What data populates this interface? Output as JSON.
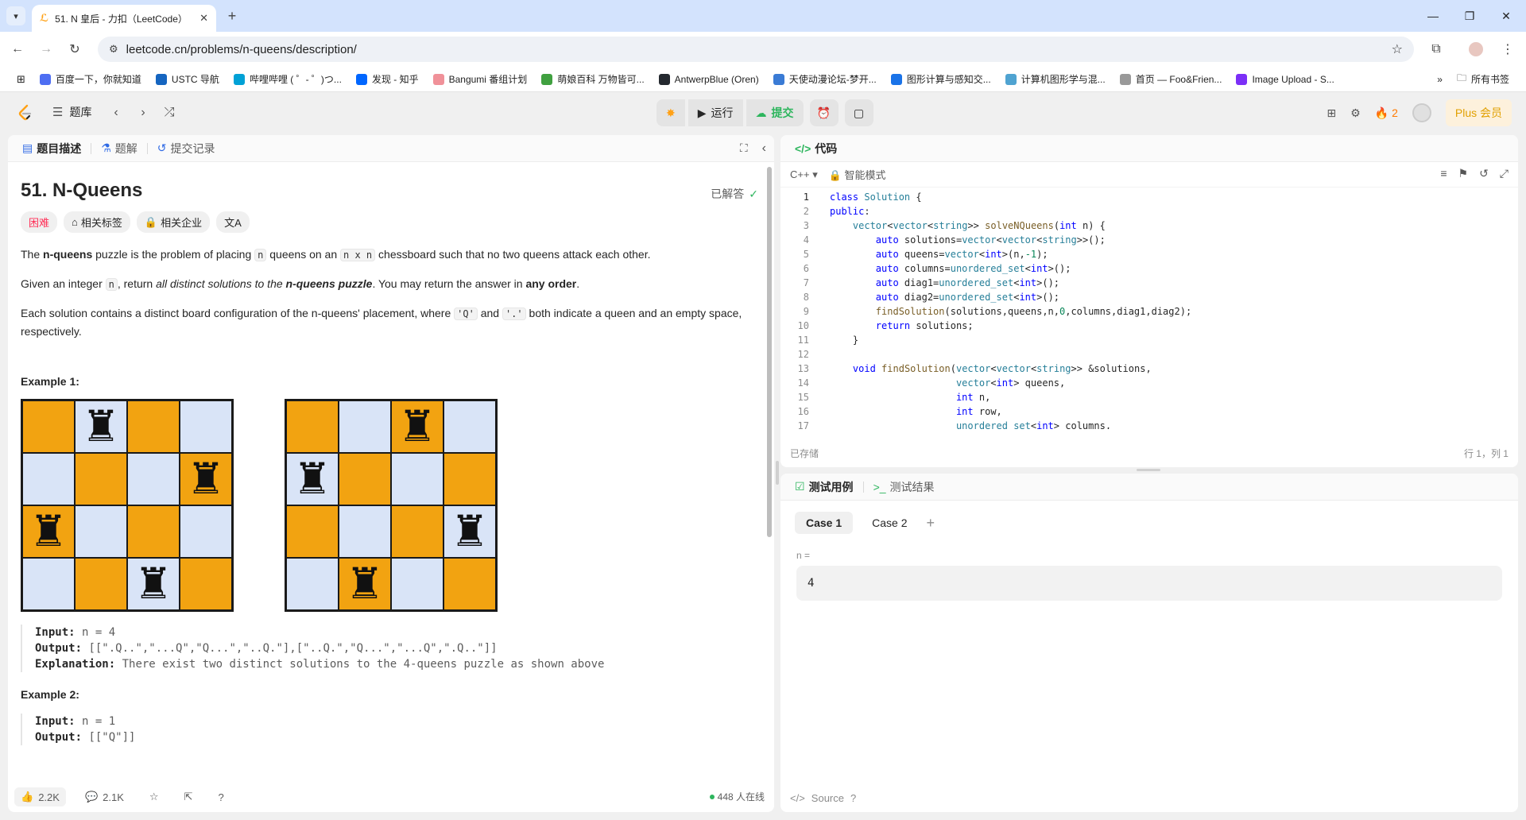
{
  "browser": {
    "tab_title": "51. N 皇后 - 力扣（LeetCode）",
    "url": "leetcode.cn/problems/n-queens/description/",
    "bookmarks": [
      {
        "label": "百度一下，你就知道",
        "color": "#4e6ef2"
      },
      {
        "label": "USTC 导航",
        "color": "#1565c0"
      },
      {
        "label": "哔哩哔哩 ( ゜- ゜)つ...",
        "color": "#00a1d6"
      },
      {
        "label": "发现 - 知乎",
        "color": "#0066ff"
      },
      {
        "label": "Bangumi 番组计划",
        "color": "#f09199"
      },
      {
        "label": "萌娘百科 万物皆可...",
        "color": "#40a040"
      },
      {
        "label": "AntwerpBlue (Oren)",
        "color": "#24292f"
      },
      {
        "label": "天使动漫论坛-梦开...",
        "color": "#3a7bd5"
      },
      {
        "label": "图形计算与感知交...",
        "color": "#1a73e8"
      },
      {
        "label": "计算机图形学与混...",
        "color": "#4fa3d1"
      },
      {
        "label": "首页 — Foo&Frien...",
        "color": "#999999"
      },
      {
        "label": "Image Upload - S...",
        "color": "#7b2ff7"
      }
    ],
    "all_bookmarks": "所有书签"
  },
  "lc": {
    "bank_label": "题库",
    "run_label": "运行",
    "submit_label": "提交",
    "streak": "2",
    "plus_label": "Plus 会员",
    "accent_green": "#2db55d",
    "accent_orange": "#ffa116"
  },
  "left": {
    "tabs": [
      "题目描述",
      "题解",
      "提交记录"
    ],
    "title": "51. N-Queens",
    "solved": "已解答",
    "tags": [
      "困难",
      "相关标签",
      "相关企业"
    ],
    "p1_a": "The ",
    "p1_b": "n-queens",
    "p1_c": " puzzle is the problem of placing ",
    "p1_code1": "n",
    "p1_d": " queens on an ",
    "p1_code2": "n x n",
    "p1_e": " chessboard such that no two queens attack each other.",
    "p2_a": "Given an integer ",
    "p2_code": "n",
    "p2_b": ", return ",
    "p2_c": "all distinct solutions to the ",
    "p2_d": "n-queens puzzle",
    "p2_e": ". You may return the answer in ",
    "p2_f": "any order",
    "p2_g": ".",
    "p3_a": "Each solution contains a distinct board configuration of the n-queens' placement, where ",
    "p3_code1": "'Q'",
    "p3_b": " and ",
    "p3_code2": "'.'",
    "p3_c": " both indicate a queen and an empty space, respectively.",
    "ex1_title": "Example 1:",
    "ex1_input_label": "Input:",
    "ex1_input": " n = 4",
    "ex1_output_label": "Output:",
    "ex1_output": " [[\".Q..\",\"...Q\",\"Q...\",\"..Q.\"],[\"..Q.\",\"Q...\",\"...Q\",\".Q..\"]]",
    "ex1_expl_label": "Explanation:",
    "ex1_expl": " There exist two distinct solutions to the 4-queens puzzle as shown above",
    "ex2_title": "Example 2:",
    "ex2_input_label": "Input:",
    "ex2_input": " n = 1",
    "ex2_output_label": "Output:",
    "ex2_output": " [[\"Q\"]]",
    "likes": "2.2K",
    "comments": "2.1K",
    "online": "448 人在线",
    "boards": [
      [
        1,
        3,
        0,
        2
      ],
      [
        2,
        0,
        3,
        1
      ]
    ],
    "queen_glyph": "♜"
  },
  "code": {
    "tab_label": "代码",
    "language": "C++",
    "mode": "智能模式",
    "saved": "已存储",
    "cursor": "行 1，列 1",
    "lines": [
      "class Solution {",
      "public:",
      "    vector<vector<string>> solveNQueens(int n) {",
      "        auto solutions=vector<vector<string>>();",
      "        auto queens=vector<int>(n,-1);",
      "        auto columns=unordered_set<int>();",
      "        auto diag1=unordered_set<int>();",
      "        auto diag2=unordered_set<int>();",
      "        findSolution(solutions,queens,n,0,columns,diag1,diag2);",
      "        return solutions;",
      "    }",
      "",
      "    void findSolution(vector<vector<string>> &solutions,",
      "                      vector<int> queens,",
      "                      int n,",
      "                      int row,",
      "                      unordered_set<int> columns,"
    ]
  },
  "test": {
    "tab_cases": "测试用例",
    "tab_results": "测试结果",
    "cases": [
      "Case 1",
      "Case 2"
    ],
    "var_label": "n =",
    "var_value": "4",
    "source_label": "Source"
  }
}
